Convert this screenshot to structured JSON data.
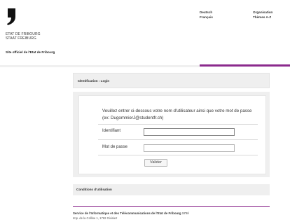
{
  "header": {
    "state_line_1": "ETAT DE FRIBOURG",
    "state_line_2": "STAAT FREIBURG",
    "site_official": "Site officiel de l'Etat de Fribourg",
    "languages": [
      "Deutsch",
      "Français"
    ],
    "links": [
      "Organisation",
      "Thèmes A-Z"
    ]
  },
  "panel": {
    "title": "Identification : Login",
    "instructions": "Veuillez entrer ci-dessous votre nom d'utilisateur ainsi que votre mot de passe (ex: DugommierJ@studentfr.ch)",
    "identifiant_label": "Identifiant",
    "identifiant_value": "",
    "password_label": "Mot de passe",
    "password_value": "",
    "submit_label": "Valider"
  },
  "conditions_label": "Conditions d'utilisation",
  "footer": {
    "service_bold": "Service de l'Informatique et des Télécommunications de l'Etat de Fribourg",
    "service_suffix": "SITel",
    "address": "Imp. de la Colline 1, 1762 Givisiez"
  },
  "colors": {
    "accent": "#8b2a8d",
    "panel_bg": "#efefef"
  }
}
